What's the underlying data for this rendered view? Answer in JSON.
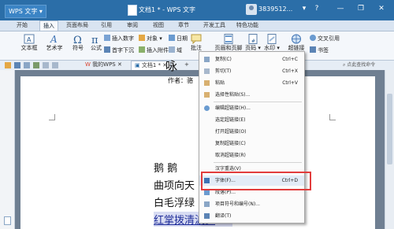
{
  "titlebar": {
    "app_button": "WPS 文字",
    "doc_title": "文档1 * - WPS 文字",
    "username": "3839512...",
    "buttons": [
      "▾",
      "?",
      "—",
      "❐",
      "✕"
    ]
  },
  "ribbon_tabs": [
    "开始",
    "插入",
    "页面布局",
    "引用",
    "审阅",
    "视图",
    "章节",
    "开发工具",
    "特色功能"
  ],
  "ribbon": {
    "large": [
      "文本框",
      "艺术字",
      "符号",
      "公式"
    ],
    "small": [
      "插入数字",
      "对象",
      "日期",
      "首字下沉",
      "插入附件",
      "域"
    ],
    "right": [
      "批注",
      "页眉和页脚",
      "页码",
      "水印",
      "超链接",
      "交叉引用",
      "书签"
    ]
  },
  "doc_tabs": {
    "tabs": [
      "我的WPS",
      "文档1 *"
    ],
    "search_placeholder": "点此查找命令"
  },
  "document": {
    "title": "咏",
    "author": "作者：骆",
    "lines": [
      "鹅 鹅",
      "曲项向天",
      "白毛浮绿",
      "红掌拨清波。"
    ]
  },
  "context_menu": {
    "items": [
      {
        "label": "复制(C)",
        "key": "Ctrl+C"
      },
      {
        "label": "剪切(T)",
        "key": "Ctrl+X"
      },
      {
        "label": "粘贴",
        "key": "Ctrl+V"
      },
      {
        "label": "选择性粘贴(S)...",
        "key": ""
      },
      {
        "label": "编辑超链接(H)...",
        "key": ""
      },
      {
        "label": "选定超链接(E)",
        "key": ""
      },
      {
        "label": "打开超链接(O)",
        "key": ""
      },
      {
        "label": "复制超链接(C)",
        "key": ""
      },
      {
        "label": "取消超链接(R)",
        "key": ""
      },
      {
        "label": "汉字重选(V)",
        "key": ""
      },
      {
        "label": "字体(F)...",
        "key": "Ctrl+D"
      },
      {
        "label": "段落(P)...",
        "key": ""
      },
      {
        "label": "项目符号和编号(N)...",
        "key": ""
      },
      {
        "label": "翻译(T)",
        "key": ""
      }
    ]
  },
  "colors": {
    "title_bar": "#2b6ea8",
    "highlight_box": "#e23c3c",
    "link_text": "#1f2d9a"
  }
}
